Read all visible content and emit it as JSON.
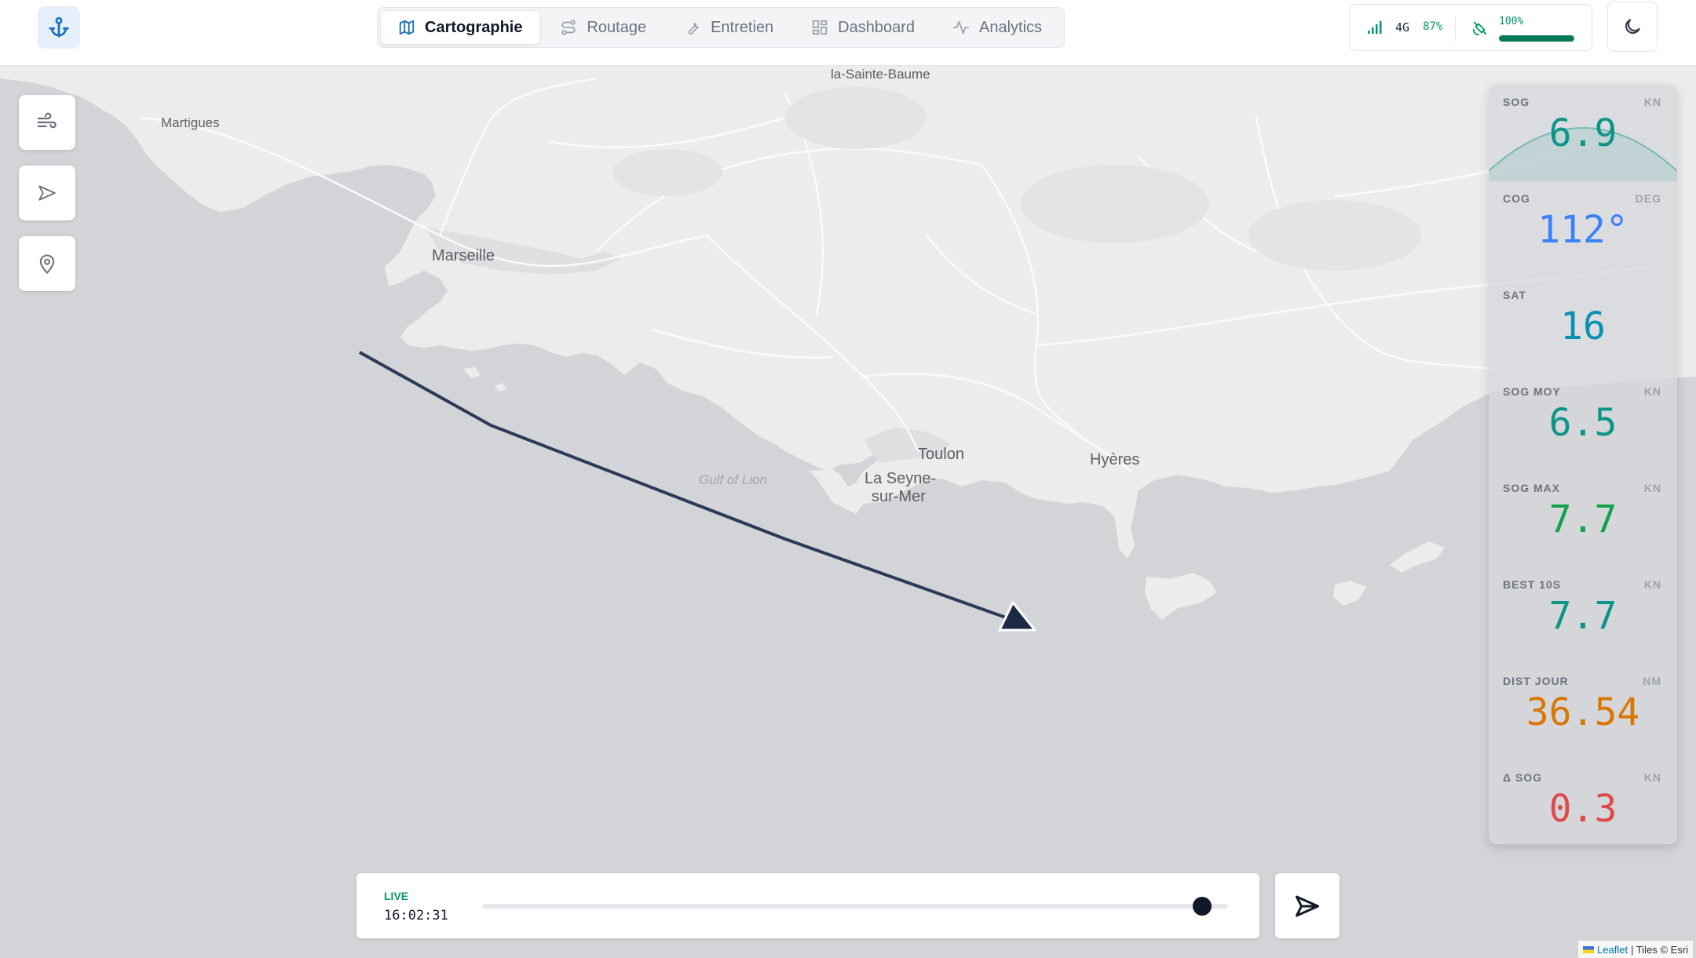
{
  "app": {
    "logo_icon": "anchor-icon",
    "accent": "#1d6fb8"
  },
  "tabs": [
    {
      "label": "Cartographie",
      "icon": "map-icon",
      "active": true
    },
    {
      "label": "Routage",
      "icon": "route-icon",
      "active": false
    },
    {
      "label": "Entretien",
      "icon": "wrench-icon",
      "active": false
    },
    {
      "label": "Dashboard",
      "icon": "dashboard-grid-icon",
      "active": false
    },
    {
      "label": "Analytics",
      "icon": "activity-icon",
      "active": false
    }
  ],
  "status": {
    "network": "4G",
    "signal_percent": "87%",
    "battery_percent": "100%",
    "battery_level": 100,
    "status_color": "#059669"
  },
  "map": {
    "places": {
      "martigues": "Martigues",
      "sainte_baume": "la-Sainte-Baume",
      "marseille": "Marseille",
      "toulon": "Toulon",
      "la_seyne_line1": "La Seyne-",
      "la_seyne_line2": "sur-Mer",
      "hyeres": "Hyères",
      "gulf": "Gulf of Lion"
    },
    "track_color": "#2b3a55"
  },
  "metrics": [
    {
      "label": "SOG",
      "unit": "KN",
      "value": "6.9",
      "color": "#0d9488"
    },
    {
      "label": "COG",
      "unit": "DEG",
      "value": "112°",
      "color": "#3b82f6"
    },
    {
      "label": "SAT",
      "unit": "",
      "value": "16",
      "color": "#0891b2"
    },
    {
      "label": "SOG MOY",
      "unit": "KN",
      "value": "6.5",
      "color": "#0d9488"
    },
    {
      "label": "SOG MAX",
      "unit": "KN",
      "value": "7.7",
      "color": "#10a34a"
    },
    {
      "label": "BEST 10S",
      "unit": "KN",
      "value": "7.7",
      "color": "#0d9488"
    },
    {
      "label": "DIST JOUR",
      "unit": "NM",
      "value": "36.54",
      "color": "#d97706"
    },
    {
      "label": "Δ SOG",
      "unit": "KN",
      "value": "0.3",
      "color": "#dc4a4a"
    }
  ],
  "timeline": {
    "mode": "LIVE",
    "time": "16:02:31",
    "position": 0.965
  },
  "attribution": {
    "leaflet": "Leaflet",
    "tiles": "| Tiles © Esri"
  }
}
